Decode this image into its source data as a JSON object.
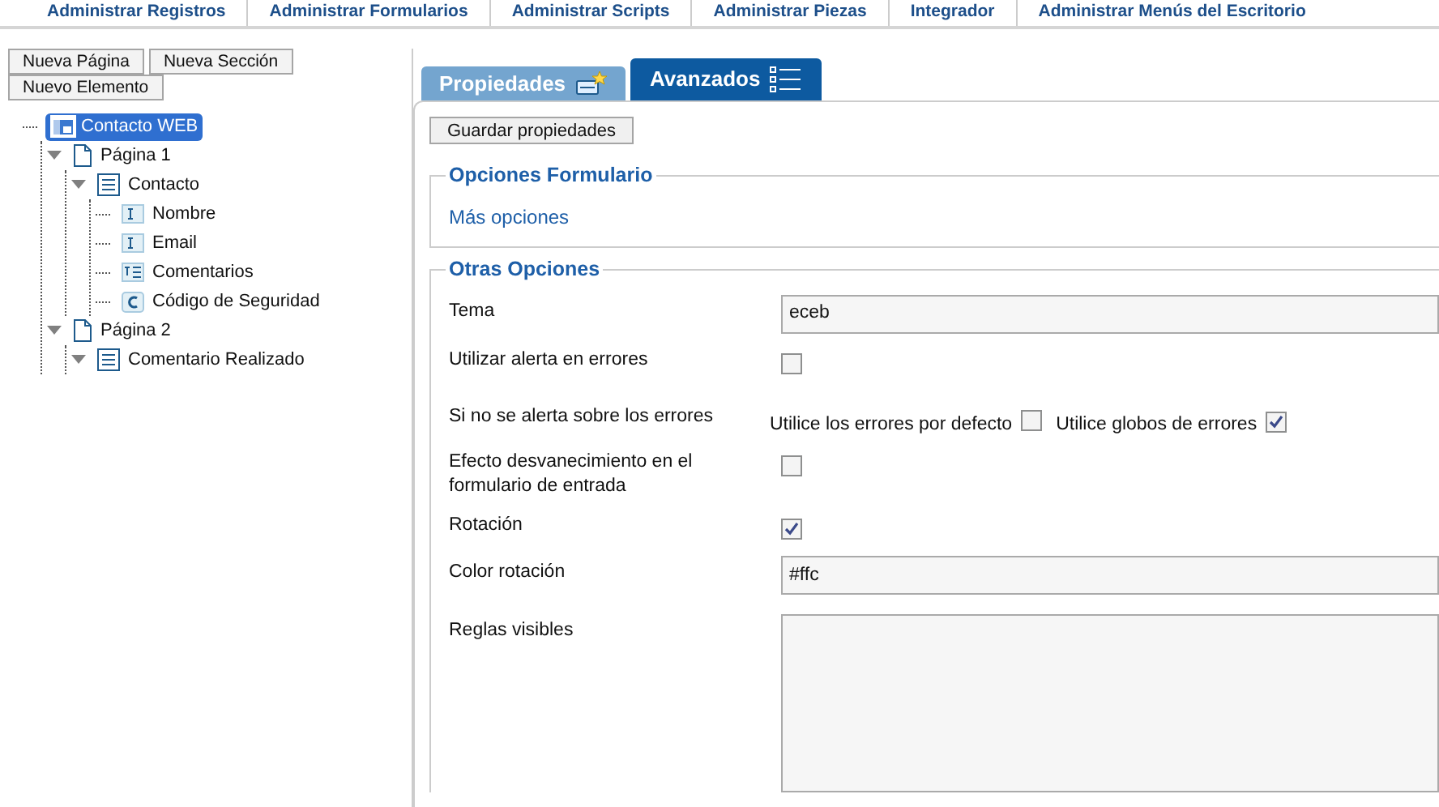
{
  "top_nav": [
    "Administrar Registros",
    "Administrar Formularios",
    "Administrar Scripts",
    "Administrar Piezas",
    "Integrador",
    "Administrar Menús del Escritorio"
  ],
  "toolbar_buttons": [
    "Nueva Página",
    "Nueva Sección",
    "Nuevo Elemento"
  ],
  "tree": [
    {
      "label": "Contacto WEB",
      "kind": "form",
      "selected": true,
      "children": [
        {
          "label": "Página 1",
          "kind": "page",
          "selected": false,
          "expanded": true,
          "children": [
            {
              "label": "Contacto",
              "kind": "section",
              "selected": false,
              "expanded": true,
              "children": [
                {
                  "label": "Nombre",
                  "kind": "text",
                  "selected": false
                },
                {
                  "label": "Email",
                  "kind": "text",
                  "selected": false
                },
                {
                  "label": "Comentarios",
                  "kind": "textarea",
                  "selected": false
                },
                {
                  "label": "Código de Seguridad",
                  "kind": "captcha",
                  "selected": false
                }
              ]
            }
          ]
        },
        {
          "label": "Página 2",
          "kind": "page",
          "selected": false,
          "expanded": true,
          "children": [
            {
              "label": "Comentario Realizado",
              "kind": "section",
              "selected": false,
              "expanded": true
            }
          ]
        }
      ]
    }
  ],
  "tabs": [
    {
      "label": "Propiedades",
      "selected": false
    },
    {
      "label": "Avanzados",
      "selected": true
    }
  ],
  "save_button": "Guardar propiedades",
  "form_options": {
    "legend": "Opciones Formulario",
    "link": "Más opciones"
  },
  "other_options": {
    "legend": "Otras Opciones",
    "rows": [
      {
        "kind": "input",
        "label": "Tema",
        "value": "eceb"
      },
      {
        "kind": "checkbox",
        "label": "Utilizar alerta en errores",
        "checked": false
      },
      {
        "kind": "choices",
        "label": "Si no se alerta sobre los errores",
        "options": [
          {
            "label": "Utilice los errores por defecto",
            "checked": false
          },
          {
            "label": "Utilice globos de errores",
            "checked": true
          }
        ]
      },
      {
        "kind": "checkbox",
        "label": "Efecto desvanecimiento en el formulario de entrada",
        "checked": false
      },
      {
        "kind": "checkbox",
        "label": "Rotación",
        "checked": true
      },
      {
        "kind": "input",
        "label": "Color rotación",
        "value": "#ffc"
      },
      {
        "kind": "textarea",
        "label": "Reglas visibles"
      }
    ]
  }
}
